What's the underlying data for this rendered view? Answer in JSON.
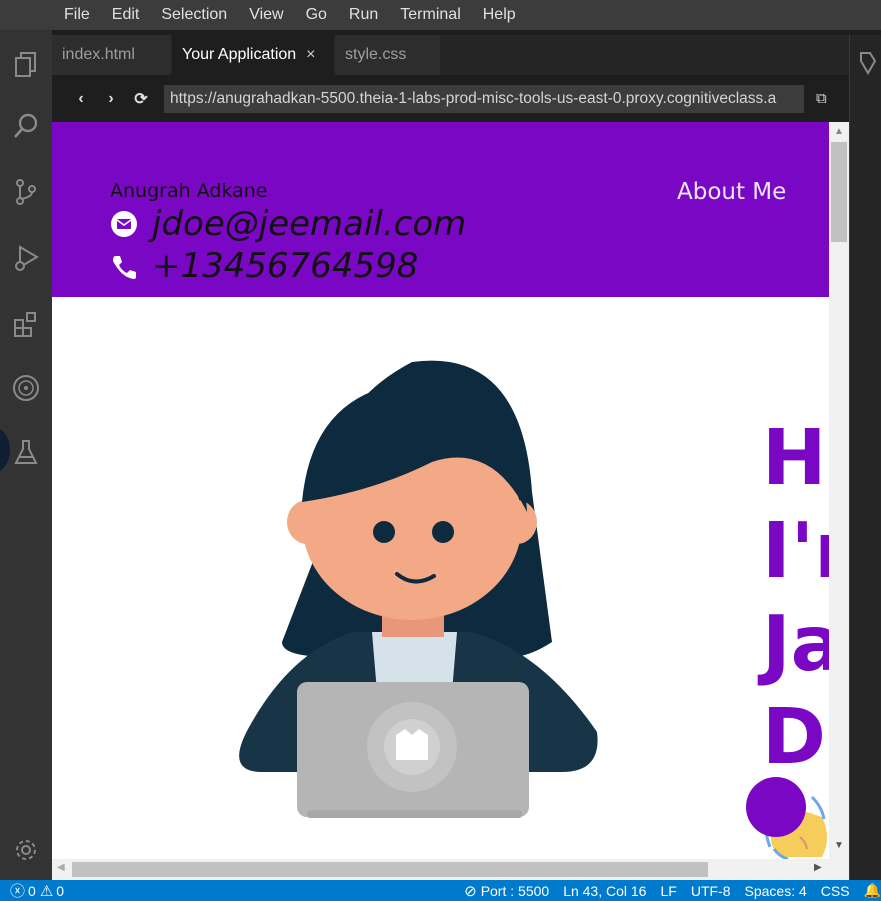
{
  "menu": [
    "File",
    "Edit",
    "Selection",
    "View",
    "Go",
    "Run",
    "Terminal",
    "Help"
  ],
  "tabs": [
    {
      "label": "index.html"
    },
    {
      "label": "Your Application",
      "close": "×"
    },
    {
      "label": "style.css"
    }
  ],
  "browser": {
    "url": "https://anugrahadkan-5500.theia-1-labs-prod-misc-tools-us-east-0.proxy.cognitiveclass.a"
  },
  "page": {
    "name": "Anugrah Adkane",
    "email": "jdoe@jeemail.com",
    "phone": "+13456764598",
    "nav_about": "About Me",
    "hero_lines": [
      "Hi",
      "I'm",
      "Ja",
      "Do"
    ]
  },
  "status": {
    "errors": "0",
    "warnings": "0",
    "port": "Port : 5500",
    "position": "Ln 43, Col 16",
    "eol": "LF",
    "encoding": "UTF-8",
    "indent": "Spaces: 4",
    "language": "CSS"
  },
  "colors": {
    "accent": "#7a07c4",
    "statusbar": "#007acc"
  }
}
